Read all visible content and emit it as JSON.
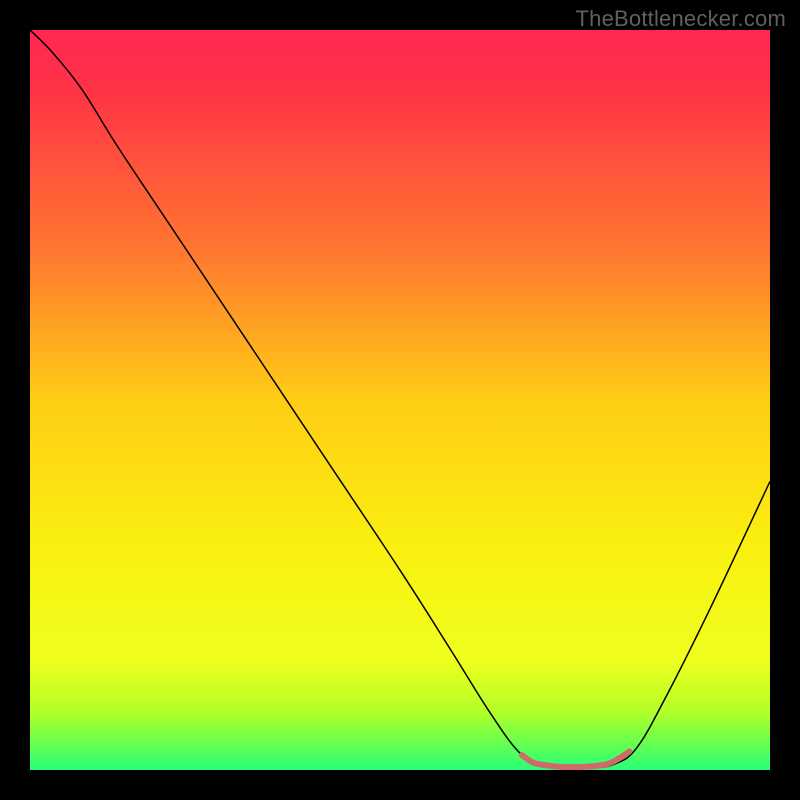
{
  "watermark": "TheBottlenecker.com",
  "chart_data": {
    "type": "line",
    "title": "",
    "xlabel": "",
    "ylabel": "",
    "xlim": [
      0,
      100
    ],
    "ylim": [
      0,
      100
    ],
    "background_gradient": {
      "stops": [
        {
          "offset": 0.0,
          "color": "#ff2850"
        },
        {
          "offset": 0.08,
          "color": "#ff3246"
        },
        {
          "offset": 0.3,
          "color": "#ff7830"
        },
        {
          "offset": 0.5,
          "color": "#ffcd14"
        },
        {
          "offset": 0.7,
          "color": "#faf010"
        },
        {
          "offset": 0.85,
          "color": "#f0ff1e"
        },
        {
          "offset": 0.92,
          "color": "#b4ff28"
        },
        {
          "offset": 0.96,
          "color": "#6eff4b"
        },
        {
          "offset": 1.0,
          "color": "#28ff78"
        }
      ]
    },
    "series": [
      {
        "name": "bottleneck-curve",
        "color": "#000000",
        "width": 1.5,
        "points": [
          {
            "x": 0,
            "y": 100
          },
          {
            "x": 3,
            "y": 97
          },
          {
            "x": 7,
            "y": 92
          },
          {
            "x": 12,
            "y": 84
          },
          {
            "x": 20,
            "y": 72
          },
          {
            "x": 30,
            "y": 57
          },
          {
            "x": 40,
            "y": 42
          },
          {
            "x": 50,
            "y": 27
          },
          {
            "x": 57,
            "y": 16
          },
          {
            "x": 62,
            "y": 8
          },
          {
            "x": 66,
            "y": 2.5
          },
          {
            "x": 69,
            "y": 0.7
          },
          {
            "x": 72,
            "y": 0.3
          },
          {
            "x": 76,
            "y": 0.3
          },
          {
            "x": 79,
            "y": 0.8
          },
          {
            "x": 82,
            "y": 3
          },
          {
            "x": 86,
            "y": 10
          },
          {
            "x": 92,
            "y": 22
          },
          {
            "x": 100,
            "y": 39
          }
        ]
      },
      {
        "name": "optimal-band",
        "color": "#cf6a6a",
        "width": 6,
        "points": [
          {
            "x": 66.5,
            "y": 2.0
          },
          {
            "x": 68,
            "y": 1.0
          },
          {
            "x": 70,
            "y": 0.6
          },
          {
            "x": 72,
            "y": 0.4
          },
          {
            "x": 74,
            "y": 0.4
          },
          {
            "x": 76,
            "y": 0.5
          },
          {
            "x": 78,
            "y": 0.8
          },
          {
            "x": 79.5,
            "y": 1.5
          },
          {
            "x": 81,
            "y": 2.5
          }
        ]
      }
    ]
  }
}
